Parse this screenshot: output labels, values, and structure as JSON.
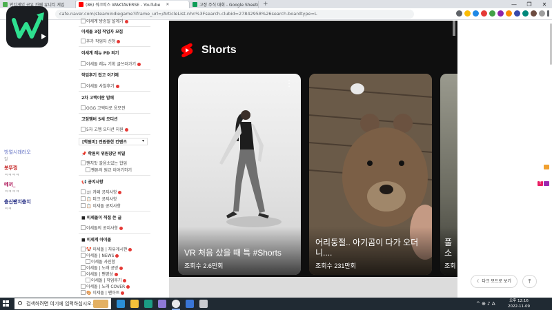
{
  "browser": {
    "tabs": [
      {
        "label": "인디게임 공유 카페 유니티 게임",
        "active": false,
        "favicon_color": "#4caf50"
      },
      {
        "label": "(86) 워크피스 WAKTAVERSE - YouTube",
        "active": true,
        "favicon_color": "#ff0000"
      },
      {
        "label": "고정 주식 대회 - Google Sheets",
        "active": false,
        "favicon_color": "#0f9d58"
      }
    ],
    "new_tab": "+",
    "window_controls": {
      "minimize": "—",
      "maximize": "❐",
      "close": "✕"
    },
    "url": "cafe.naver.com/steamindiegame?iframe_url=/ArticleList.nhn%3Fsearch.clubid=27842958%26search.boardtype=L"
  },
  "sidebar": {
    "rows": [
      {
        "kind": "item",
        "text": "이세계 방송일 설계기",
        "dot": true
      },
      {
        "kind": "head",
        "text": "이세돌 3집 작업자 모집"
      },
      {
        "kind": "item",
        "text": "추가 작업자 신청",
        "dot": true
      },
      {
        "kind": "head",
        "text": "이세계 레뉴 PD 되기"
      },
      {
        "kind": "item",
        "text": "이세돌 레뉴 기획 글쓰러가기",
        "dot": true
      },
      {
        "kind": "head",
        "text": "작업후기 접고 이기에"
      },
      {
        "kind": "item",
        "text": "이세돌 사찰후기",
        "dot": true
      },
      {
        "kind": "head",
        "text": "2차 고백이란 밤에"
      },
      {
        "kind": "item",
        "text": "OGG 고백타로 응모전"
      },
      {
        "kind": "head",
        "text": "고정멤버 5세 오디션"
      },
      {
        "kind": "item",
        "text": "5차 고멤 오디션 지원",
        "dot": true
      },
      {
        "kind": "headbox",
        "text": "[학원미] 전원중한 컨텐츠"
      },
      {
        "kind": "head",
        "text": "📌 학원의 위원장단 비밀"
      },
      {
        "kind": "item",
        "text": "팬치맛 갈음소있는 합업"
      },
      {
        "kind": "sub",
        "text": "팬톤의 원교 이야기하기"
      },
      {
        "kind": "head",
        "text": "📢 공지사항"
      },
      {
        "kind": "item",
        "text": "📰 카페 공지사항",
        "dot": true
      },
      {
        "kind": "item",
        "text": "📋 미크 공지사항"
      },
      {
        "kind": "item",
        "text": "📋 이세돌 공지사항"
      },
      {
        "kind": "head",
        "text": "■ 이세돌이 직접 쓴 글"
      },
      {
        "kind": "item",
        "text": "이세돌의 공지사항",
        "dot": true
      },
      {
        "kind": "head",
        "text": "■ 이세계 아이돌"
      },
      {
        "kind": "item",
        "text": "🤡 이세돌 | 자유게시판",
        "dot": true
      },
      {
        "kind": "item",
        "text": "이세돌 | NEWS",
        "dot": true
      },
      {
        "kind": "sub",
        "text": "이세돌 사진함"
      },
      {
        "kind": "item",
        "text": "이세돌 | 노래 공방",
        "dot": true
      },
      {
        "kind": "item",
        "text": "이세돌 | 팬영상",
        "dot": true
      },
      {
        "kind": "sub",
        "text": "이세돌 | 작업후기",
        "dot": true
      },
      {
        "kind": "item",
        "text": "이세돌 | 노래 COVER",
        "dot": true
      },
      {
        "kind": "item",
        "text": "🎨 이세돌 | 팬아트",
        "dot": true
      }
    ]
  },
  "shorts": {
    "title": "Shorts",
    "cards": [
      {
        "title": "VR 처음 샀을 때 특 #Shorts",
        "views": "조회수 2.6만회"
      },
      {
        "title": "어리둥절.. 아기곰이 다가 오더니....",
        "views": "조회수 231만회"
      },
      {
        "title": "풀소",
        "views": "조회"
      }
    ],
    "menu_glyph": "⋮"
  },
  "chat": {
    "lines": [
      {
        "name": "방얼시래러오",
        "msg": "잘",
        "color": "#5c6bc0",
        "badge": ""
      },
      {
        "name": "봇뚜껑",
        "msg": "ㅋㅋㅋㅋ",
        "color": "#c62828",
        "badge": "#f0a030"
      },
      {
        "name": "떼끼_",
        "msg": "ㅋㅋㅋㅋ",
        "color": "#ad1457",
        "badge": "#e91e63"
      },
      {
        "name": "충신팬치충치",
        "msg": "ㅋㅋ",
        "color": "#1a237e",
        "badge": ""
      }
    ],
    "dark_mode_label": "다크 모드로 보기",
    "top_button": "⤒"
  },
  "taskbar": {
    "search_placeholder": "검색하려면 여기에 입력하십시오.",
    "tray": "^ ⊕ ♪ A",
    "time": "오후 12:16",
    "date": "2022-11-09"
  }
}
